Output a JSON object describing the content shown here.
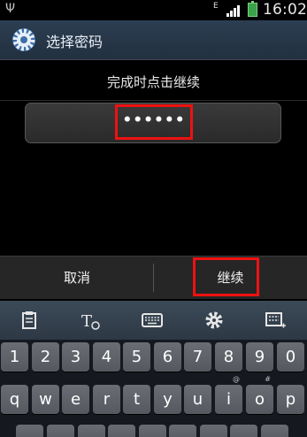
{
  "status_bar": {
    "network_type": "E",
    "time": "16:02",
    "icons": [
      "usb-icon",
      "signal-icon",
      "battery-charging-icon"
    ]
  },
  "title_bar": {
    "title": "选择密码",
    "icon": "gear-icon"
  },
  "instruction": "完成时点击继续",
  "password": {
    "masked_value": "••••••"
  },
  "buttons": {
    "cancel": "取消",
    "continue": "继续"
  },
  "keyboard": {
    "toolbar_icons": [
      "clipboard-icon",
      "handwriting-icon",
      "keyboard-icon",
      "settings-icon",
      "emoticon-icon"
    ],
    "number_row": [
      "1",
      "2",
      "3",
      "4",
      "5",
      "6",
      "7",
      "8",
      "9",
      "0"
    ],
    "letter_row": [
      "q",
      "w",
      "e",
      "r",
      "t",
      "y",
      "u",
      "i",
      "o",
      "p"
    ],
    "letter_row_alt": [
      "",
      "",
      "",
      "",
      "",
      "",
      "",
      "@",
      "#",
      ""
    ]
  },
  "colors": {
    "highlight": "#ee1111",
    "titlebar": "#2c3e52",
    "battery": "#3aa24a"
  }
}
